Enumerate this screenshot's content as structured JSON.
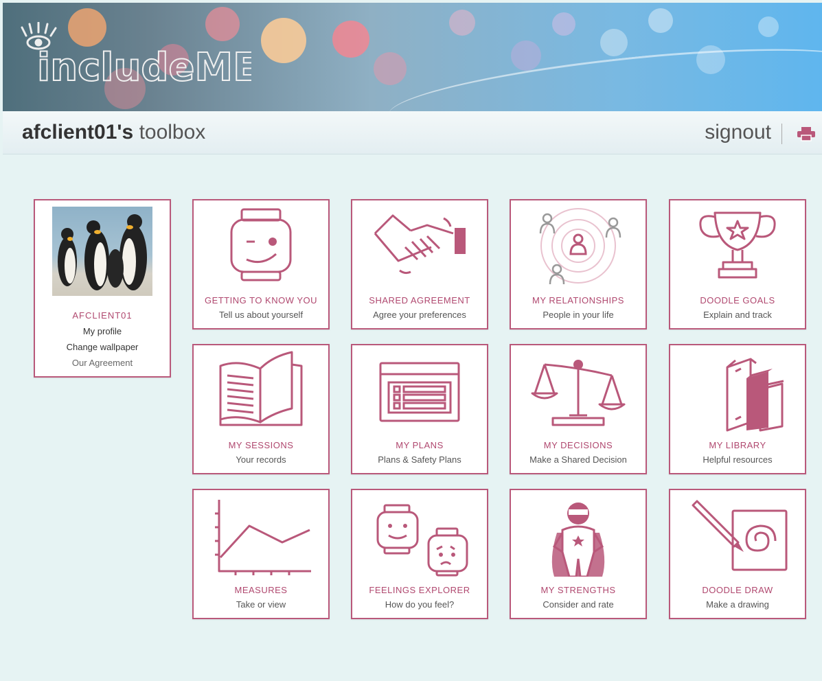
{
  "header": {
    "logo_text": "includeME",
    "username": "afclient01's",
    "title_suffix": "toolbox",
    "signout_label": "signout",
    "print_icon": "print-icon"
  },
  "profile": {
    "name": "AFCLIENT01",
    "links": [
      "My profile",
      "Change wallpaper",
      "Our Agreement"
    ]
  },
  "tiles": [
    {
      "title": "GETTING TO KNOW YOU",
      "subtitle": "Tell us about yourself",
      "icon": "face-icon"
    },
    {
      "title": "SHARED AGREEMENT",
      "subtitle": "Agree your preferences",
      "icon": "handshake-icon"
    },
    {
      "title": "MY RELATIONSHIPS",
      "subtitle": "People in your life",
      "icon": "relationships-icon"
    },
    {
      "title": "DOODLE GOALS",
      "subtitle": "Explain and track",
      "icon": "trophy-icon"
    },
    {
      "title": "MY SESSIONS",
      "subtitle": "Your records",
      "icon": "book-icon"
    },
    {
      "title": "MY PLANS",
      "subtitle": "Plans & Safety Plans",
      "icon": "plan-list-icon"
    },
    {
      "title": "MY DECISIONS",
      "subtitle": "Make a Shared Decision",
      "icon": "scales-icon"
    },
    {
      "title": "MY LIBRARY",
      "subtitle": "Helpful resources",
      "icon": "books-icon"
    },
    {
      "title": "MEASURES",
      "subtitle": "Take or view",
      "icon": "line-chart-icon"
    },
    {
      "title": "FEELINGS EXPLORER",
      "subtitle": "How do you feel?",
      "icon": "feelings-icon"
    },
    {
      "title": "MY STRENGTHS",
      "subtitle": "Consider and rate",
      "icon": "superhero-icon"
    },
    {
      "title": "DOODLE DRAW",
      "subtitle": "Make a drawing",
      "icon": "pencil-drawing-icon"
    }
  ],
  "colors": {
    "accent": "#b9587a",
    "accent_text": "#b0486f",
    "page_bg": "#e6f3f3"
  }
}
